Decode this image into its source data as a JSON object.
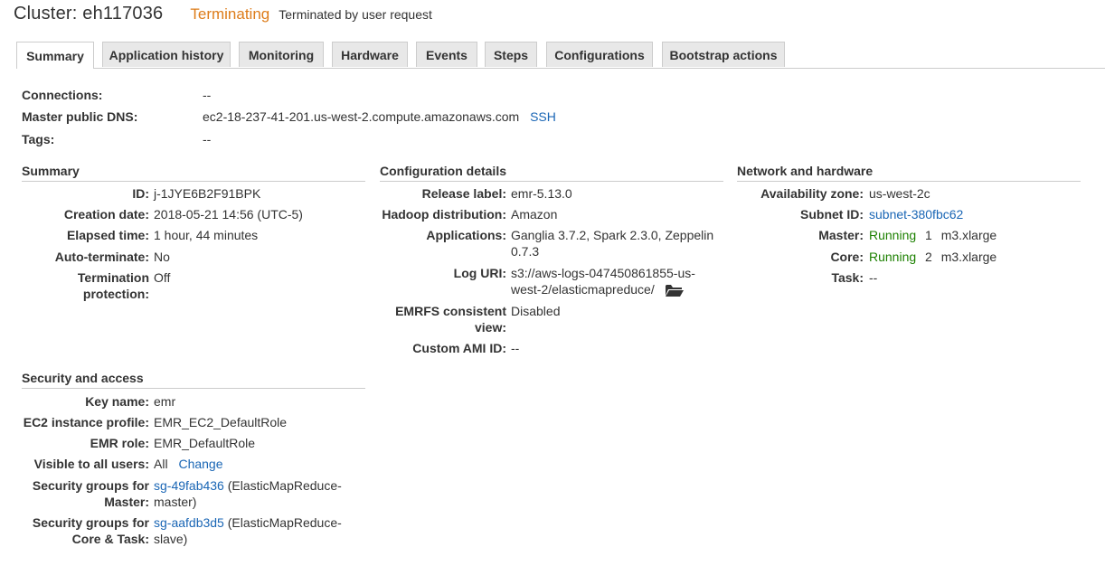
{
  "header": {
    "title": "Cluster: eh117036",
    "status": "Terminating",
    "status_reason": "Terminated by user request",
    "status_color": "#dd7c1a"
  },
  "tabs": [
    {
      "label": "Summary",
      "active": true
    },
    {
      "label": "Application history"
    },
    {
      "label": "Monitoring"
    },
    {
      "label": "Hardware"
    },
    {
      "label": "Events"
    },
    {
      "label": "Steps"
    },
    {
      "label": "Configurations"
    },
    {
      "label": "Bootstrap actions"
    }
  ],
  "top_info": {
    "connections_label": "Connections:",
    "connections_value": "--",
    "dns_label": "Master public DNS:",
    "dns_value": "ec2-18-237-41-201.us-west-2.compute.amazonaws.com",
    "ssh_link": "SSH",
    "tags_label": "Tags:",
    "tags_value": "--"
  },
  "summary": {
    "title": "Summary",
    "id_label": "ID:",
    "id_value": "j-1JYE6B2F91BPK",
    "creation_label": "Creation date:",
    "creation_value": "2018-05-21 14:56 (UTC-5)",
    "elapsed_label": "Elapsed time:",
    "elapsed_value": "1 hour, 44 minutes",
    "autoterm_label": "Auto-terminate:",
    "autoterm_value": "No",
    "termprot_label_1": "Termination",
    "termprot_label_2": "protection:",
    "termprot_value": "Off"
  },
  "config": {
    "title": "Configuration details",
    "release_label": "Release label:",
    "release_value": "emr-5.13.0",
    "hadoop_label": "Hadoop distribution:",
    "hadoop_value": "Amazon",
    "apps_label": "Applications:",
    "apps_value_1": "Ganglia 3.7.2, Spark 2.3.0, Zeppelin",
    "apps_value_2": "0.7.3",
    "log_label": "Log URI:",
    "log_value_1": "s3://aws-logs-047450861855-us-",
    "log_value_2": "west-2/elasticmapreduce/",
    "emrfs_label_1": "EMRFS consistent",
    "emrfs_label_2": "view:",
    "emrfs_value": "Disabled",
    "ami_label": "Custom AMI ID:",
    "ami_value": "--"
  },
  "network": {
    "title": "Network and hardware",
    "az_label": "Availability zone:",
    "az_value": "us-west-2c",
    "subnet_label": "Subnet ID:",
    "subnet_value": "subnet-380fbc62",
    "master_label": "Master:",
    "master_status": "Running",
    "master_count": "1",
    "master_type": "m3.xlarge",
    "core_label": "Core:",
    "core_status": "Running",
    "core_count": "2",
    "core_type": "m3.xlarge",
    "task_label": "Task:",
    "task_value": "--"
  },
  "security": {
    "title": "Security and access",
    "key_label": "Key name:",
    "key_value": "emr",
    "ec2_label": "EC2 instance profile:",
    "ec2_value": "EMR_EC2_DefaultRole",
    "role_label": "EMR role:",
    "role_value": "EMR_DefaultRole",
    "visible_label": "Visible to all users:",
    "visible_value": "All",
    "change_link": "Change",
    "sgm_label_1": "Security groups for",
    "sgm_label_2": "Master:",
    "sgm_link": "sg-49fab436",
    "sgm_value_1": " (ElasticMapReduce-",
    "sgm_value_2": "master)",
    "sgc_label_1": "Security groups for",
    "sgc_label_2": "Core & Task:",
    "sgc_link": "sg-aafdb3d5",
    "sgc_value_1": " (ElasticMapReduce-",
    "sgc_value_2": "slave)"
  }
}
